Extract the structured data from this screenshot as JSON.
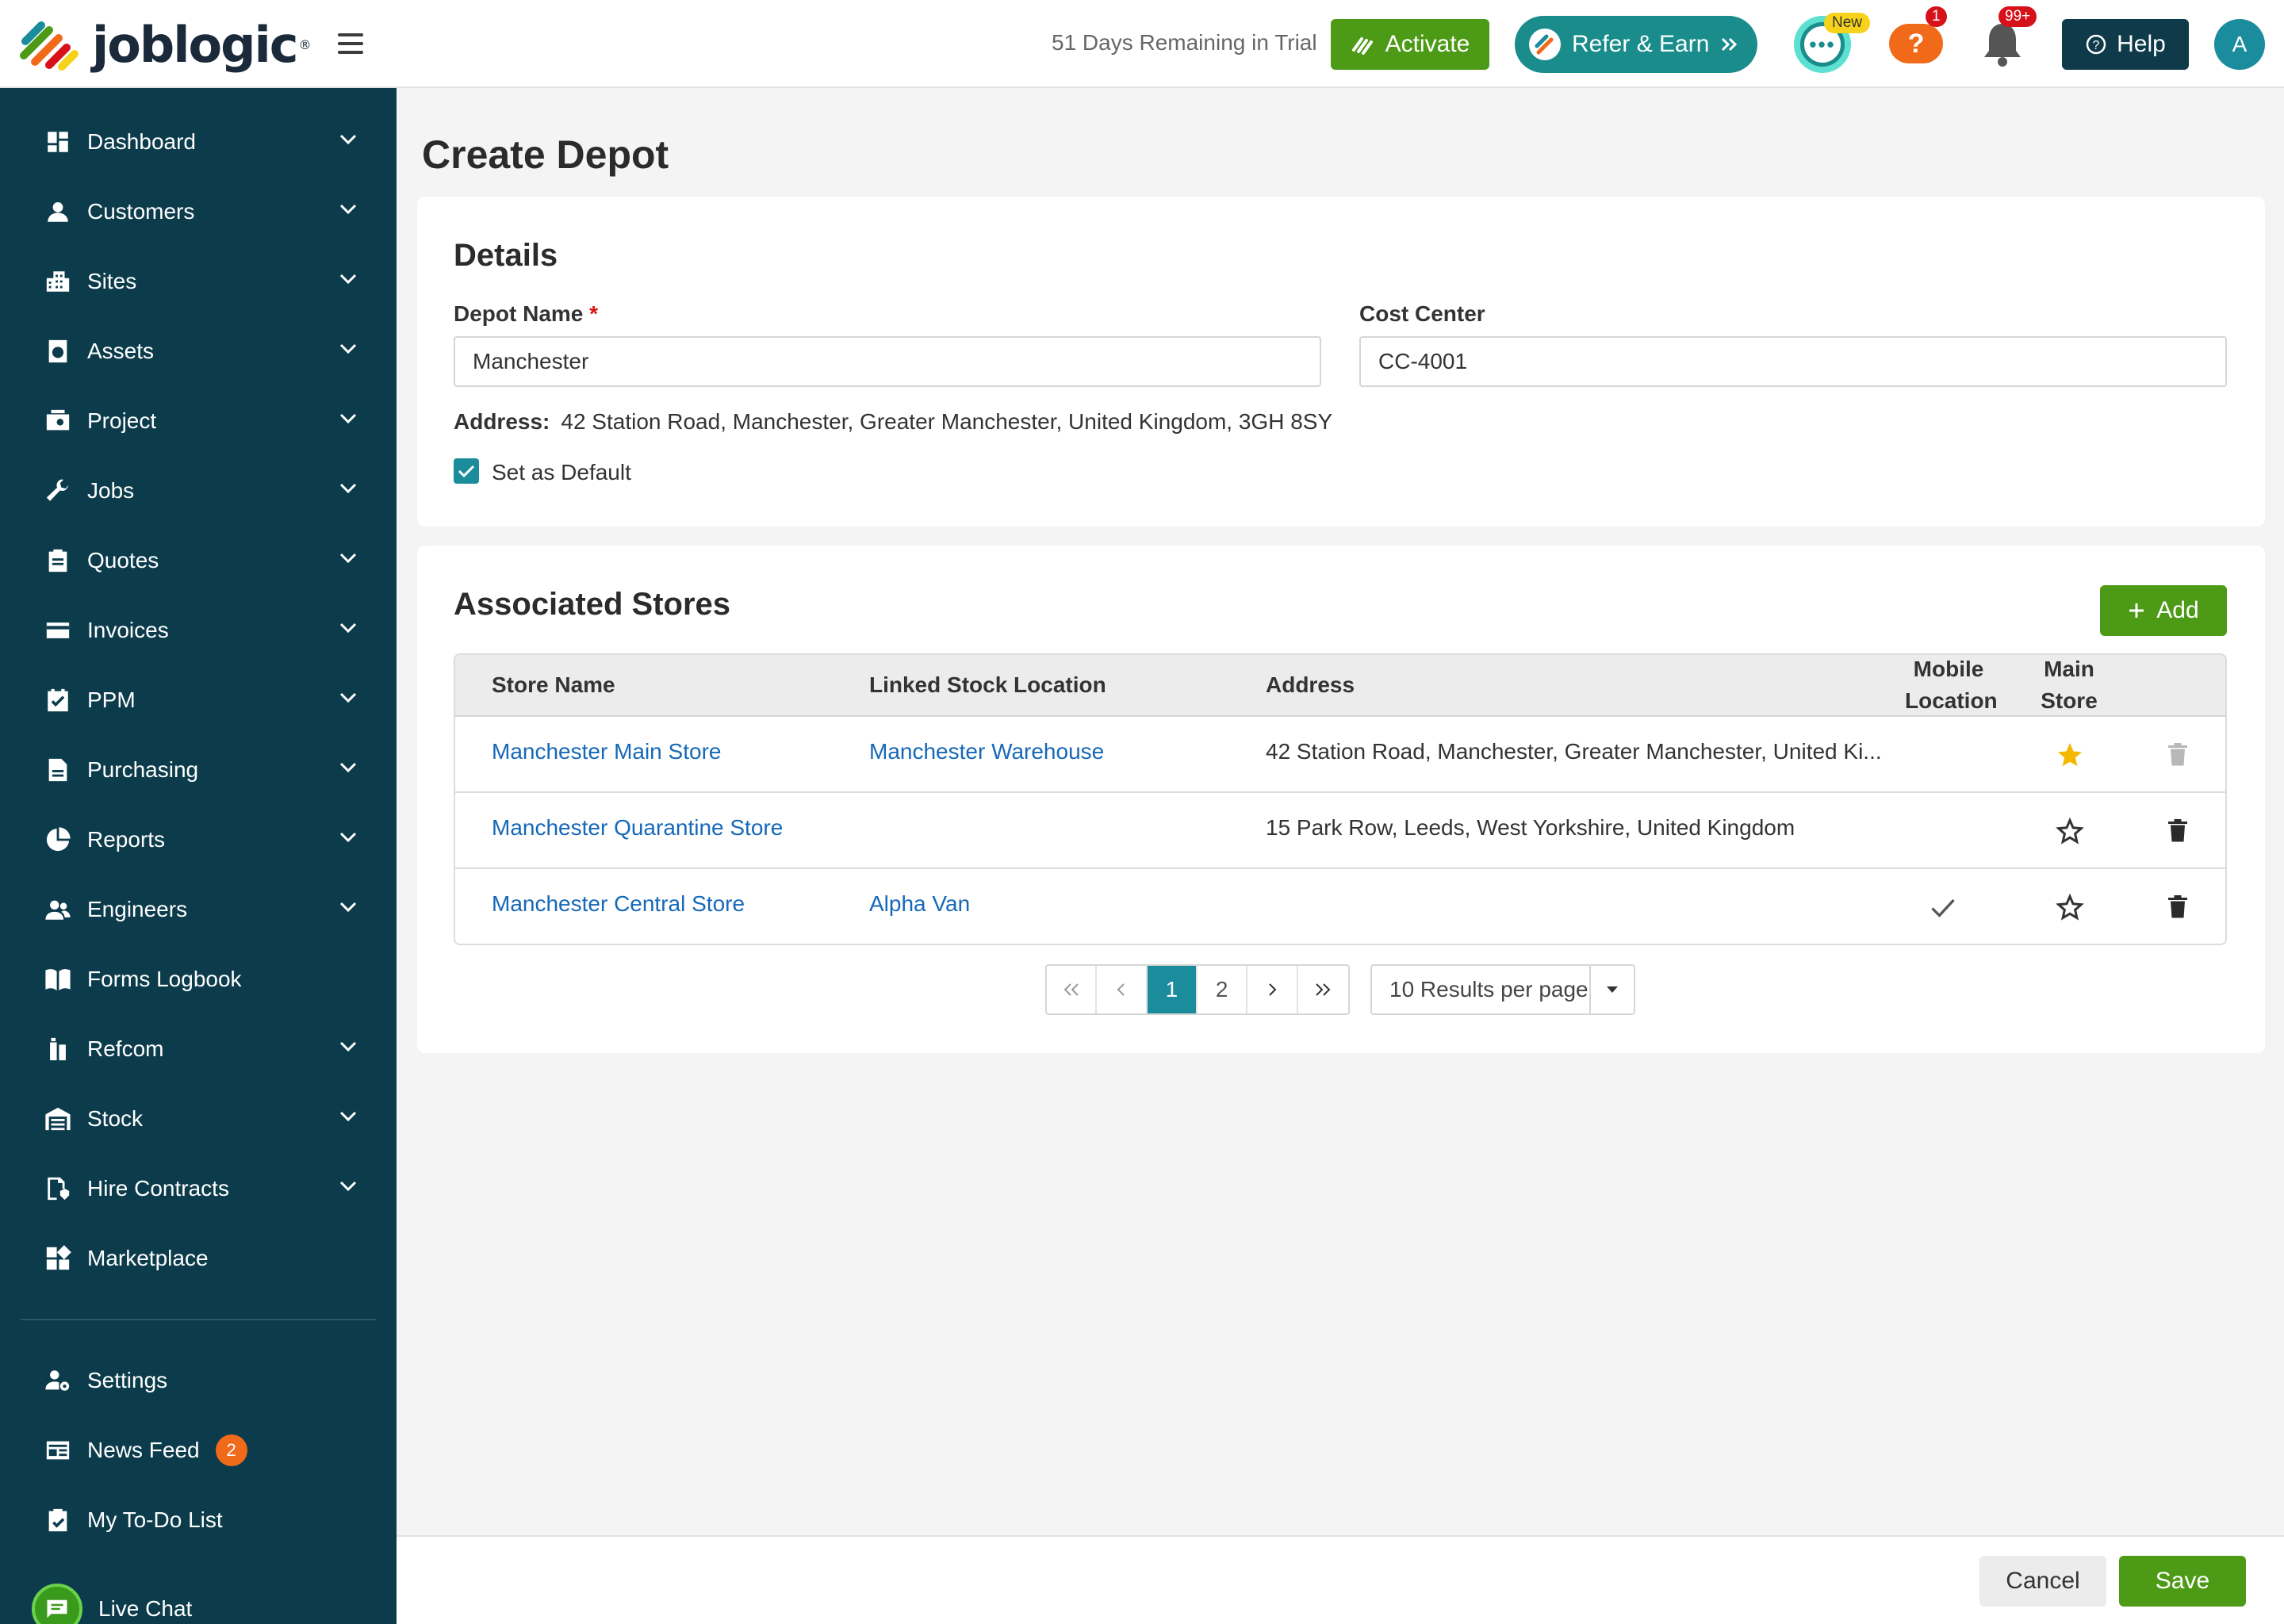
{
  "header": {
    "logo_text": "joblogic",
    "trial_text": "51 Days Remaining in Trial",
    "activate_label": "Activate",
    "refer_label": "Refer & Earn",
    "chat_badge": "New",
    "help_badge": "1",
    "notif_badge": "99+",
    "help_label": "Help",
    "avatar_initial": "A",
    "accent": "#1a8c9c",
    "brand_green": "#4c9a16"
  },
  "sidebar": {
    "items": [
      {
        "label": "Dashboard",
        "icon": "dashboard-icon",
        "has_chevron": true
      },
      {
        "label": "Customers",
        "icon": "person-icon",
        "has_chevron": true
      },
      {
        "label": "Sites",
        "icon": "building-icon",
        "has_chevron": true
      },
      {
        "label": "Assets",
        "icon": "asset-icon",
        "has_chevron": true
      },
      {
        "label": "Project",
        "icon": "project-icon",
        "has_chevron": true
      },
      {
        "label": "Jobs",
        "icon": "wrench-icon",
        "has_chevron": true
      },
      {
        "label": "Quotes",
        "icon": "clipboard-icon",
        "has_chevron": true
      },
      {
        "label": "Invoices",
        "icon": "card-icon",
        "has_chevron": true
      },
      {
        "label": "PPM",
        "icon": "calendar-check-icon",
        "has_chevron": true
      },
      {
        "label": "Purchasing",
        "icon": "document-icon",
        "has_chevron": true
      },
      {
        "label": "Reports",
        "icon": "pie-chart-icon",
        "has_chevron": true
      },
      {
        "label": "Engineers",
        "icon": "group-icon",
        "has_chevron": true
      },
      {
        "label": "Forms Logbook",
        "icon": "book-icon",
        "has_chevron": false
      },
      {
        "label": "Refcom",
        "icon": "cylinder-icon",
        "has_chevron": true
      },
      {
        "label": "Stock",
        "icon": "warehouse-icon",
        "has_chevron": true
      },
      {
        "label": "Hire Contracts",
        "icon": "contract-icon",
        "has_chevron": true
      },
      {
        "label": "Marketplace",
        "icon": "grid-icon",
        "has_chevron": false
      }
    ],
    "bottom": {
      "settings": "Settings",
      "news_feed": "News Feed",
      "news_count": "2",
      "todo": "My To-Do List",
      "live_chat": "Live Chat"
    }
  },
  "page": {
    "title": "Create Depot"
  },
  "details": {
    "heading": "Details",
    "depot_name_label": "Depot Name",
    "depot_name_required": "*",
    "depot_name_value": "Manchester",
    "cost_center_label": "Cost Center",
    "cost_center_value": "CC-4001",
    "address_label": "Address:",
    "address_value": "42 Station Road, Manchester, Greater Manchester, United Kingdom, 3GH 8SY",
    "default_label": "Set as Default",
    "default_checked": true
  },
  "stores": {
    "heading": "Associated Stores",
    "add_label": "Add",
    "columns": {
      "store_name": "Store Name",
      "linked": "Linked Stock Location",
      "address": "Address",
      "mobile_1": "Mobile",
      "mobile_2": "Location",
      "main_1": "Main",
      "main_2": "Store"
    },
    "rows": [
      {
        "name": "Manchester Main Store",
        "linked": "Manchester Warehouse",
        "address": "42 Station Road, Manchester, Greater Manchester, United Ki...",
        "mobile": false,
        "main": true,
        "delete_disabled": true
      },
      {
        "name": "Manchester Quarantine Store",
        "linked": "",
        "address": "15 Park Row, Leeds, West Yorkshire, United Kingdom",
        "mobile": false,
        "main": false,
        "delete_disabled": false
      },
      {
        "name": "Manchester Central Store",
        "linked": "Alpha Van",
        "address": "",
        "mobile": true,
        "main": false,
        "delete_disabled": false
      }
    ],
    "pagination": {
      "pages": [
        "1",
        "2"
      ],
      "current": "1",
      "per_page": "10 Results per page"
    }
  },
  "footer": {
    "cancel_label": "Cancel",
    "save_label": "Save"
  }
}
